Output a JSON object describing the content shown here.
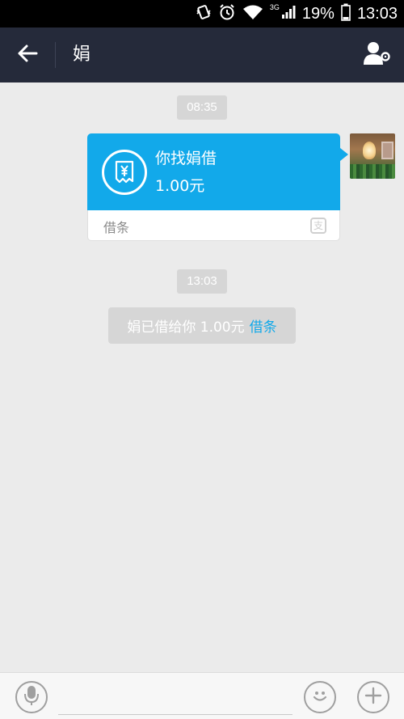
{
  "status_bar": {
    "network": "3G",
    "battery_percent": "19%",
    "time": "13:03"
  },
  "header": {
    "title": "娟",
    "back_icon": "arrow-left-icon",
    "profile_icon": "person-settings-icon"
  },
  "messages": {
    "time_1": "08:35",
    "loan_card": {
      "title": "你找娟借",
      "amount": "1.00元",
      "footer_label": "借条",
      "icon": "receipt-yuan-icon",
      "brand_icon": "alipay-icon",
      "brand_mark": "支"
    },
    "time_2": "13:03",
    "system_message": {
      "text": "娟已借给你 1.00元",
      "link_text": "借条"
    }
  },
  "input_bar": {
    "voice_icon": "microphone-icon",
    "input_value": "",
    "input_placeholder": "",
    "emoji_icon": "smiley-icon",
    "plus_icon": "plus-icon"
  },
  "colors": {
    "accent": "#12a9ea",
    "header_bg": "#252a3a",
    "chat_bg": "#ebebeb"
  }
}
